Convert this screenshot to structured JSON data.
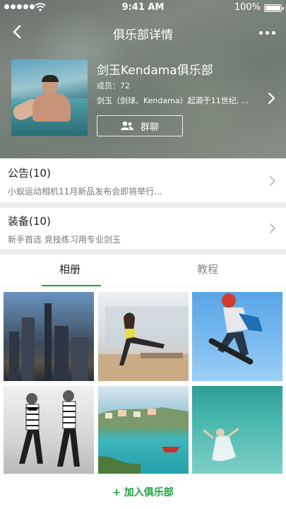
{
  "status_bar": {
    "time": "9:41 AM",
    "battery": "100%",
    "battery_level": 1.0
  },
  "nav": {
    "title": "俱乐部详情",
    "back_icon": "chevron-left-icon",
    "more_icon": "more-dots-icon"
  },
  "club": {
    "name": "剑玉Kendama俱乐部",
    "members": "成员：72",
    "description": "剑玉（剑球、Kendama）起源于11世纪, ...",
    "group_chat_label": "群聊"
  },
  "announcement": {
    "title": "公告(10)",
    "subtitle": "小蚁运动相机11月新品发布会即将举行..."
  },
  "equipment": {
    "title": "装备(10)",
    "subtitle": "新手首选 竞技练习用专业剑玉"
  },
  "tabs": [
    {
      "label": "相册",
      "active": true
    },
    {
      "label": "教程",
      "active": false
    }
  ],
  "colors": {
    "accent": "#1ba43c",
    "inactive_tab": "#888888"
  },
  "photos": [
    "city-night",
    "yoga-studio",
    "skateboard",
    "fashion-bw",
    "seaside-town",
    "underwater"
  ],
  "join_button": "+ 加入俱乐部"
}
